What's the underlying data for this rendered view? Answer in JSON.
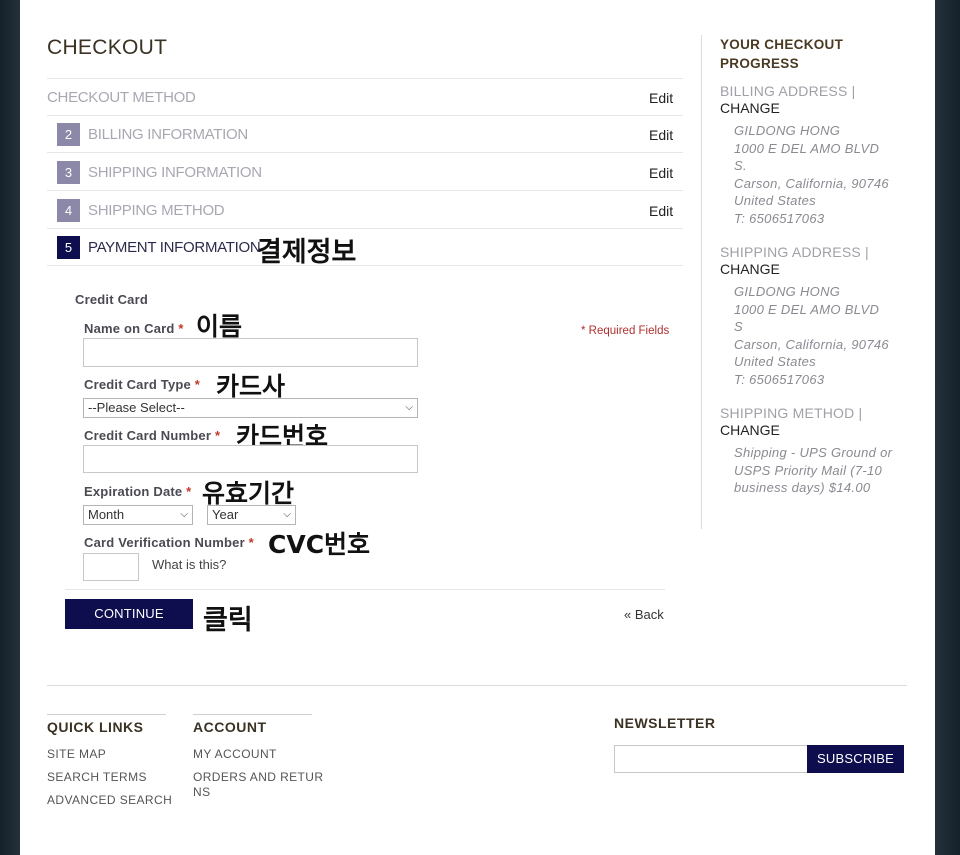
{
  "checkout": {
    "title": "CHECKOUT",
    "steps": [
      {
        "num": "",
        "label": "CHECKOUT METHOD",
        "edit": "Edit"
      },
      {
        "num": "2",
        "label": "BILLING INFORMATION",
        "edit": "Edit"
      },
      {
        "num": "3",
        "label": "SHIPPING INFORMATION",
        "edit": "Edit"
      },
      {
        "num": "4",
        "label": "SHIPPING METHOD",
        "edit": "Edit"
      },
      {
        "num": "5",
        "label": "PAYMENT INFORMATION",
        "edit": ""
      }
    ],
    "annotation_payment": "결제정보"
  },
  "payment": {
    "section_title": "Credit Card",
    "required_note": "* Required Fields",
    "name_label": "Name on Card",
    "name_annotation": "이름",
    "type_label": "Credit Card Type",
    "type_annotation": "카드사",
    "type_selected": "--Please Select--",
    "number_label": "Credit Card Number",
    "number_annotation": "카드번호",
    "exp_label": "Expiration Date",
    "exp_annotation": "유효기간",
    "month_selected": "Month",
    "year_selected": "Year",
    "cvv_label": "Card Verification Number",
    "cvv_annotation": "CVC번호",
    "cvv_help": "What is this?",
    "asterisk": "*",
    "continue_label": "CONTINUE",
    "continue_annotation": "클릭",
    "back_label": "« Back"
  },
  "progress": {
    "title_line1": "YOUR CHECKOUT",
    "title_line2": "PROGRESS",
    "billing_label": "BILLING ADDRESS |",
    "change": "CHANGE",
    "billing_lines": [
      "GILDONG HONG",
      "1000 E DEL AMO BLVD",
      "S.",
      "Carson, California, 90746",
      "United States",
      "T: 6506517063"
    ],
    "shipping_label": "SHIPPING ADDRESS |",
    "shipping_lines": [
      "GILDONG HONG",
      "1000 E DEL AMO BLVD",
      "S",
      "Carson, California, 90746",
      "United States",
      "T: 6506517063"
    ],
    "method_label": "SHIPPING METHOD |",
    "method_lines": [
      "Shipping - UPS Ground or",
      "USPS Priority Mail (7-10",
      "business days) $14.00"
    ]
  },
  "footer": {
    "quick_links_title": "QUICK LINKS",
    "quick_links": [
      "SITE MAP",
      "SEARCH TERMS",
      "ADVANCED SEARCH"
    ],
    "account_title": "ACCOUNT",
    "account_links": [
      "MY ACCOUNT",
      "ORDERS AND RETUR",
      "NS"
    ],
    "newsletter_title": "NEWSLETTER",
    "subscribe_label": "SUBSCRIBE"
  }
}
